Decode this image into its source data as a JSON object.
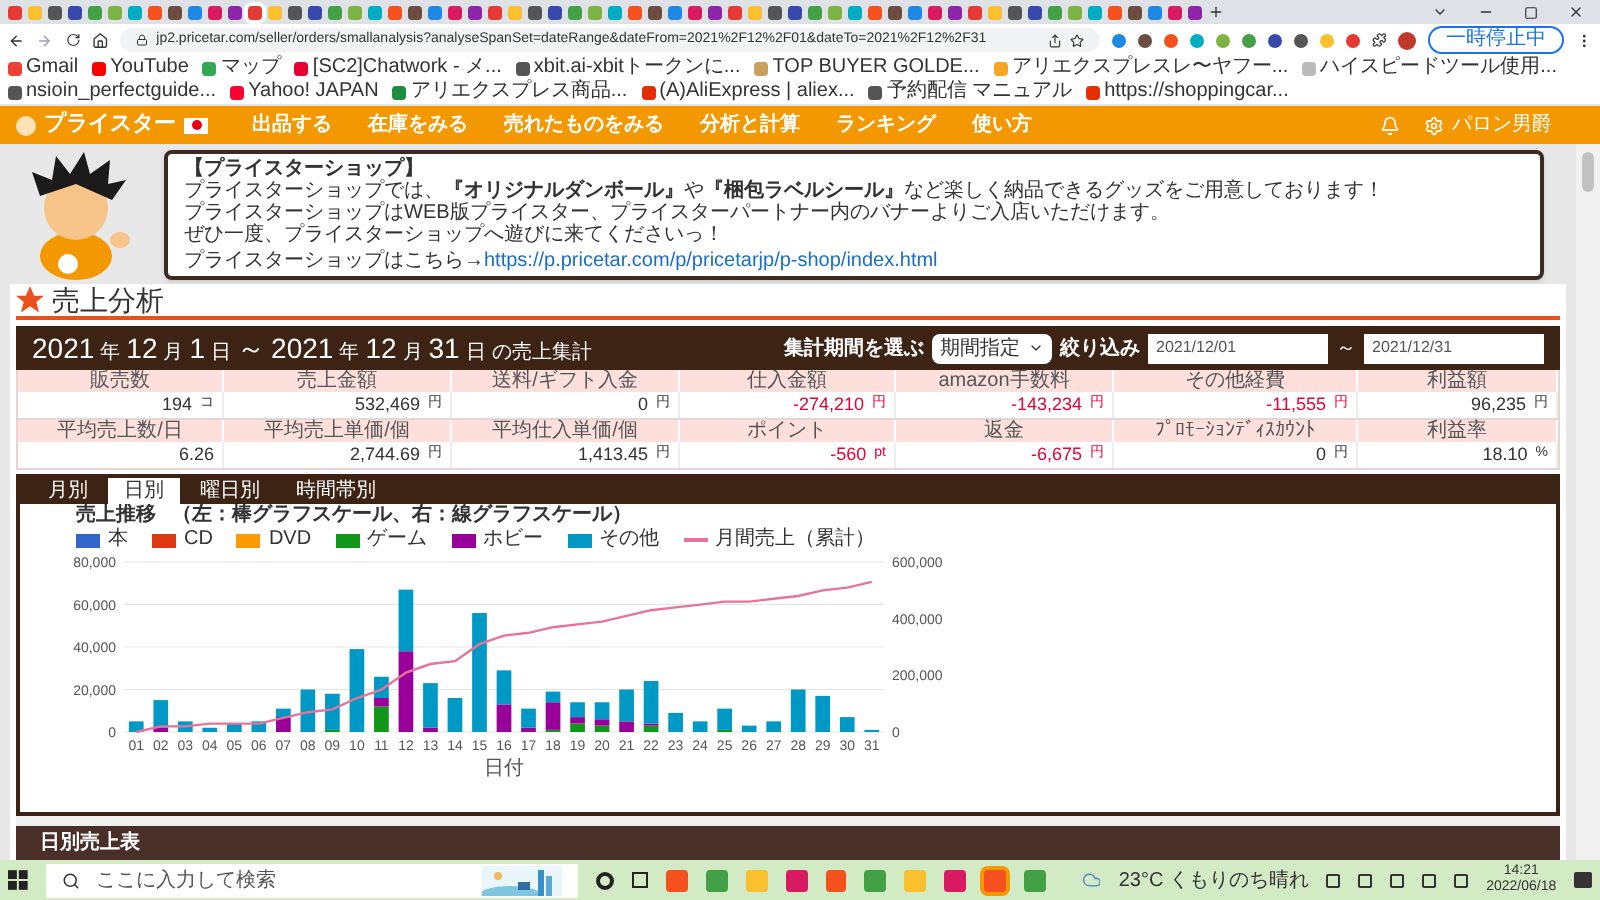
{
  "browser": {
    "url": "jp2.pricetar.com/seller/orders/smallanalysis?analyseSpanSet=dateRange&dateFrom=2021%2F12%2F01&dateTo=2021%2F12%2F31",
    "profile_button": "一時停止中",
    "bookmarks": [
      {
        "label": "Gmail",
        "color": "#ea4335"
      },
      {
        "label": "YouTube",
        "color": "#ff0000"
      },
      {
        "label": "マップ",
        "color": "#34a853"
      },
      {
        "label": "[SC2]Chatwork - メ...",
        "color": "#e60033"
      },
      {
        "label": "xbit.ai-xbitトークンに...",
        "color": "#555555"
      },
      {
        "label": "TOP BUYER GOLDE...",
        "color": "#c8a060"
      },
      {
        "label": "アリエクスプレスレ〜ヤフー...",
        "color": "#f5a623"
      },
      {
        "label": "ハイスピードツール使用...",
        "color": "#bbbbbb"
      },
      {
        "label": "nsioin_perfectguide...",
        "color": "#555555"
      },
      {
        "label": "Yahoo! JAPAN",
        "color": "#ff0033"
      },
      {
        "label": "アリエクスプレス商品...",
        "color": "#1e8e3e"
      },
      {
        "label": "(A)AliExpress | aliex...",
        "color": "#e62e04"
      },
      {
        "label": "予約配信 マニュアル",
        "color": "#555555"
      },
      {
        "label": "https://shoppingcar...",
        "color": "#e62e04"
      }
    ]
  },
  "nav": {
    "logo": "プライスター",
    "items": [
      "出品する",
      "在庫をみる",
      "売れたものをみる",
      "分析と計算",
      "ランキング",
      "使い方"
    ],
    "user": "パロン男爵"
  },
  "banner": {
    "lines": [
      "【プライスターショップ】",
      "プライスターショップでは、**『オリジナルダンボール』**や**『梱包ラベルシール』**など楽しく納品できるグッズをご用意しております！",
      "プライスターショップはWEB版プライスター、プライスターパートナー内のバナーよりご入店いただけます。",
      "ぜひ一度、プライスターショップへ遊びに来てくださいっ！"
    ],
    "link_prefix": "プライスターショップはこちら→",
    "link": "https://p.pricetar.com/p/pricetarjp/p-shop/index.html"
  },
  "page_title": "売上分析",
  "period": [
    {
      "text": "2021",
      "kind": "num"
    },
    {
      "text": "年",
      "kind": "unit"
    },
    {
      "text": "12",
      "kind": "num"
    },
    {
      "text": "月",
      "kind": "unit"
    },
    {
      "text": "1",
      "kind": "num"
    },
    {
      "text": "日",
      "kind": "unit"
    },
    {
      "text": "～",
      "kind": "num"
    },
    {
      "text": "2021",
      "kind": "num"
    },
    {
      "text": "年",
      "kind": "unit"
    },
    {
      "text": "12",
      "kind": "num"
    },
    {
      "text": "月",
      "kind": "unit"
    },
    {
      "text": "31",
      "kind": "num"
    },
    {
      "text": "日",
      "kind": "unit"
    },
    {
      "text": "の売上集計",
      "kind": "unit"
    }
  ],
  "filter": {
    "label": "集計期間を選ぶ",
    "select": "期間指定",
    "button": "絞り込み",
    "from": "2021/12/01",
    "separator": "～",
    "to": "2021/12/31"
  },
  "stats": [
    [
      {
        "label": "販売数",
        "value": "194",
        "unit": "コ",
        "negative": false
      },
      {
        "label": "売上金額",
        "value": "532,469",
        "unit": "円",
        "negative": false
      },
      {
        "label": "送料/ギフト入金",
        "value": "0",
        "unit": "円",
        "negative": false
      },
      {
        "label": "仕入金額",
        "value": "-274,210",
        "unit": "円",
        "negative": true
      },
      {
        "label": "amazon手数料",
        "value": "-143,234",
        "unit": "円",
        "negative": true
      },
      {
        "label": "その他経費",
        "value": "-11,555",
        "unit": "円",
        "negative": true
      },
      {
        "label": "利益額",
        "value": "96,235",
        "unit": "円",
        "negative": false
      }
    ],
    [
      {
        "label": "平均売上数/日",
        "value": "6.26",
        "negative": false
      },
      {
        "label": "平均売上単価/個",
        "value": "2,744.69",
        "unit": "円",
        "negative": false
      },
      {
        "label": "平均仕入単価/個",
        "value": "1,413.45",
        "unit": "円",
        "negative": false
      },
      {
        "label": "ポイント",
        "value": "-560",
        "unit": "pt",
        "negative": true
      },
      {
        "label": "返金",
        "value": "-6,675",
        "unit": "円",
        "negative": true
      },
      {
        "label": "ﾌﾟﾛﾓｰｼｮﾝﾃﾞｨｽｶｳﾝﾄ",
        "value": "0",
        "unit": "円",
        "negative": false
      },
      {
        "label": "利益率",
        "value": "18.10",
        "unit": "%",
        "negative": false
      }
    ]
  ],
  "tabs": [
    {
      "label": "月別",
      "selected": false
    },
    {
      "label": "日別",
      "selected": true
    },
    {
      "label": "曜日別",
      "selected": false
    },
    {
      "label": "時間帯別",
      "selected": false
    }
  ],
  "chart": {
    "title": "売上推移",
    "subtitle": "（左：棒グラフスケール、右：線グラフスケール）",
    "chart_data": {
      "type": "bar",
      "stacked": true,
      "grid": true,
      "xlabel": "日付",
      "categories": [
        "01",
        "02",
        "03",
        "04",
        "05",
        "06",
        "07",
        "08",
        "09",
        "10",
        "11",
        "12",
        "13",
        "14",
        "15",
        "16",
        "17",
        "18",
        "19",
        "20",
        "21",
        "22",
        "23",
        "24",
        "25",
        "26",
        "27",
        "28",
        "29",
        "30",
        "31"
      ],
      "ylim": [
        0,
        80000
      ],
      "yticks": [
        {
          "value": 0,
          "label": "0"
        },
        {
          "value": 20000,
          "label": "20,000"
        },
        {
          "value": 40000,
          "label": "40,000"
        },
        {
          "value": 60000,
          "label": "60,000"
        },
        {
          "value": 80000,
          "label": "80,000"
        }
      ],
      "y2lim": [
        0,
        600000
      ],
      "y2ticks": [
        {
          "value": 0,
          "label": "0"
        },
        {
          "value": 200000,
          "label": "200,000"
        },
        {
          "value": 400000,
          "label": "400,000"
        },
        {
          "value": 600000,
          "label": "600,000"
        }
      ],
      "series": [
        {
          "name": "本",
          "color": "#3366cc",
          "type": "bar",
          "values": [
            0,
            0,
            0,
            0,
            0,
            0,
            0,
            0,
            0,
            0,
            0,
            0,
            0,
            0,
            0,
            0,
            0,
            0,
            0,
            0,
            0,
            0,
            0,
            0,
            0,
            0,
            0,
            0,
            0,
            0,
            0
          ]
        },
        {
          "name": "CD",
          "color": "#dc3912",
          "type": "bar",
          "values": [
            0,
            0,
            0,
            0,
            0,
            0,
            0,
            0,
            0,
            0,
            0,
            0,
            0,
            0,
            0,
            0,
            0,
            0,
            0,
            0,
            0,
            0,
            0,
            0,
            0,
            0,
            0,
            0,
            0,
            0,
            0
          ]
        },
        {
          "name": "DVD",
          "color": "#ff9900",
          "type": "bar",
          "values": [
            0,
            0,
            0,
            0,
            0,
            0,
            0,
            0,
            0,
            0,
            0,
            0,
            0,
            0,
            0,
            0,
            0,
            0,
            0,
            0,
            0,
            0,
            0,
            0,
            0,
            0,
            0,
            0,
            0,
            0,
            0
          ]
        },
        {
          "name": "ゲーム",
          "color": "#109618",
          "type": "bar",
          "values": [
            0,
            0,
            0,
            0,
            0,
            0,
            0,
            0,
            1000,
            0,
            12000,
            0,
            0,
            0,
            0,
            0,
            0,
            1000,
            4000,
            3000,
            0,
            3000,
            0,
            0,
            1000,
            0,
            0,
            0,
            0,
            0,
            0
          ]
        },
        {
          "name": "ホビー",
          "color": "#990099",
          "type": "bar",
          "values": [
            0,
            2000,
            0,
            0,
            0,
            0,
            7000,
            0,
            0,
            0,
            4000,
            38000,
            2000,
            0,
            0,
            13000,
            2000,
            13000,
            3000,
            3000,
            5000,
            1000,
            0,
            0,
            0,
            0,
            0,
            0,
            0,
            0,
            0
          ]
        },
        {
          "name": "その他",
          "color": "#0099c6",
          "type": "bar",
          "values": [
            5000,
            13000,
            5000,
            2000,
            4000,
            5000,
            4000,
            20000,
            17000,
            39000,
            10000,
            29000,
            21000,
            16000,
            56000,
            16000,
            9000,
            5000,
            7000,
            8000,
            15000,
            20000,
            9000,
            5000,
            10000,
            3000,
            5000,
            20000,
            17000,
            7000,
            1000
          ]
        },
        {
          "name": "月間売上（累計）",
          "color": "#e67399",
          "type": "line",
          "axis": "y2",
          "values": [
            0,
            20000,
            20000,
            30000,
            30000,
            30000,
            50000,
            70000,
            80000,
            120000,
            150000,
            210000,
            240000,
            250000,
            310000,
            340000,
            350000,
            370000,
            380000,
            390000,
            410000,
            430000,
            440000,
            450000,
            460000,
            460000,
            470000,
            480000,
            500000,
            510000,
            530000
          ]
        }
      ]
    }
  },
  "daily_table": {
    "title": "日別売上表"
  },
  "taskbar": {
    "search_placeholder": "ここに入力して検索",
    "weather": "23°C くもりのち晴れ",
    "time": "14:21",
    "date": "2022/06/18"
  }
}
